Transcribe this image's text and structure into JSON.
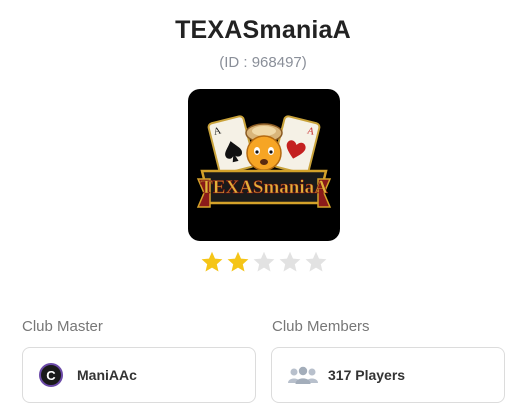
{
  "club": {
    "name": "TEXASmaniaA",
    "id_text": "(ID : 968497)",
    "logo_text": "TEXASmaniaA",
    "rating": 2,
    "rating_max": 5
  },
  "club_master": {
    "label": "Club Master",
    "name": "ManiAAc",
    "avatar_icon": "avatar-c-icon"
  },
  "club_members": {
    "label": "Club Members",
    "count_text": "317 Players",
    "icon": "people-icon"
  },
  "colors": {
    "star_filled": "#f5c518",
    "star_empty": "#e2e2e2",
    "logo_bg": "#000000",
    "logo_gold": "#d4a22a",
    "logo_red": "#c42020"
  }
}
